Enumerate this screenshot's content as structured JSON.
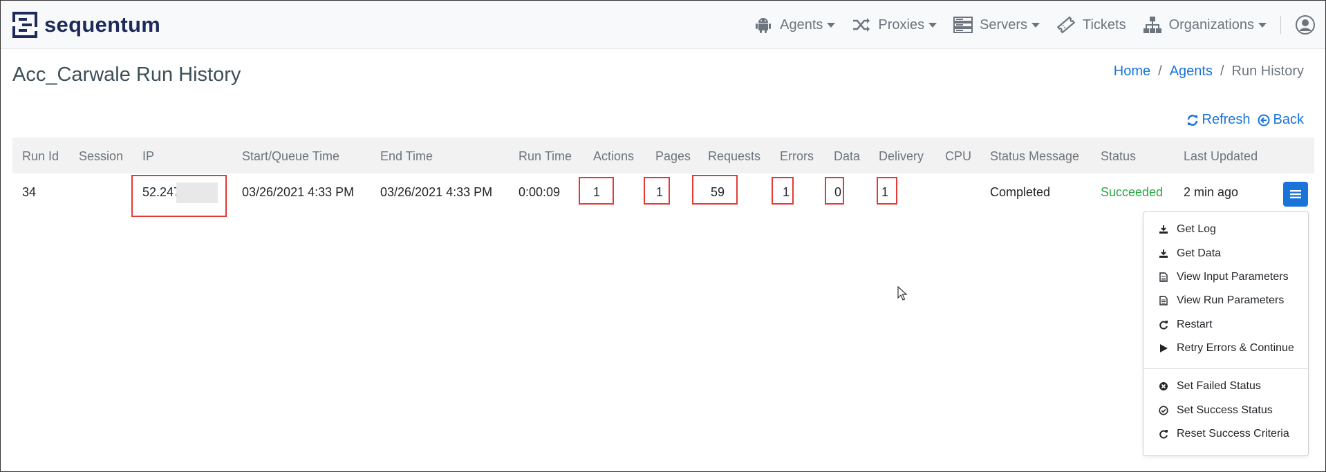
{
  "brand": {
    "name": "sequentum"
  },
  "nav": [
    {
      "label": "Agents",
      "icon": "android-icon",
      "dropdown": true
    },
    {
      "label": "Proxies",
      "icon": "shuffle-icon",
      "dropdown": true
    },
    {
      "label": "Servers",
      "icon": "server-icon",
      "dropdown": true
    },
    {
      "label": "Tickets",
      "icon": "ticket-icon",
      "dropdown": false
    },
    {
      "label": "Organizations",
      "icon": "sitemap-icon",
      "dropdown": true
    }
  ],
  "page": {
    "title": "Acc_Carwale Run History",
    "breadcrumb": {
      "home": "Home",
      "agents": "Agents",
      "current": "Run History",
      "sep": "/"
    },
    "refresh_label": "Refresh",
    "back_label": "Back"
  },
  "table": {
    "headers": {
      "run_id": "Run Id",
      "session": "Session",
      "ip": "IP",
      "start": "Start/Queue Time",
      "end": "End Time",
      "run_time": "Run Time",
      "actions": "Actions",
      "pages": "Pages",
      "requests": "Requests",
      "errors": "Errors",
      "data": "Data",
      "delivery": "Delivery",
      "cpu": "CPU",
      "status_message": "Status Message",
      "status": "Status",
      "last_updated": "Last Updated"
    },
    "row": {
      "run_id": "34",
      "session": "",
      "ip": "52.247",
      "start": "03/26/2021 4:33 PM",
      "end": "03/26/2021 4:33 PM",
      "run_time": "0:00:09",
      "actions": "1",
      "pages": "1",
      "requests": "59",
      "errors": "1",
      "data": "0",
      "delivery": "1",
      "cpu": "",
      "status_message": "Completed",
      "status": "Succeeded",
      "last_updated": "2 min ago"
    }
  },
  "menu": {
    "get_log": "Get Log",
    "get_data": "Get Data",
    "view_input": "View Input Parameters",
    "view_run": "View Run Parameters",
    "restart": "Restart",
    "retry": "Retry Errors & Continue",
    "set_failed": "Set Failed Status",
    "set_success": "Set Success Status",
    "reset_criteria": "Reset Success Criteria"
  },
  "colors": {
    "accent": "#1a73d9",
    "success": "#28a745",
    "highlight": "#e53935",
    "brand": "#1e2a5a"
  }
}
